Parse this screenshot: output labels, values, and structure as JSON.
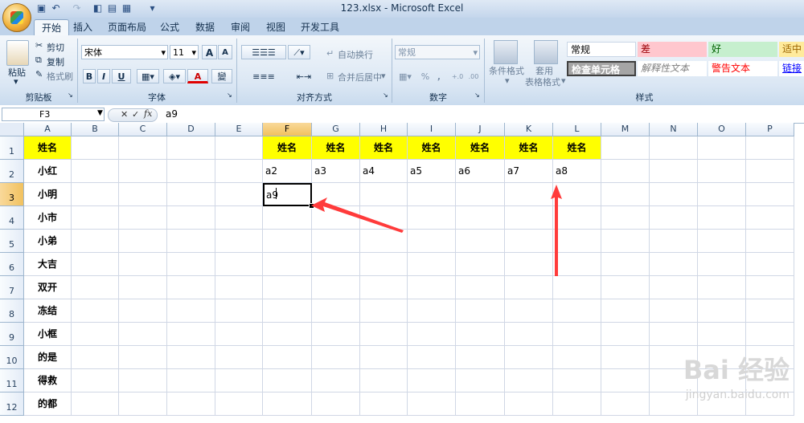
{
  "window": {
    "title": "123.xlsx - Microsoft Excel"
  },
  "tabs": [
    "开始",
    "插入",
    "页面布局",
    "公式",
    "数据",
    "审阅",
    "视图",
    "开发工具"
  ],
  "ribbon": {
    "clipboard": {
      "group": "剪贴板",
      "paste": "粘贴",
      "cut": "剪切",
      "copy": "复制",
      "format_painter": "格式刷"
    },
    "font": {
      "group": "字体",
      "name": "宋体",
      "size": "11",
      "bold": "B",
      "italic": "I",
      "underline": "U",
      "font_color": "A",
      "grow": "A",
      "shrink": "A",
      "phonetic": "變"
    },
    "alignment": {
      "group": "对齐方式",
      "wrap": "自动换行",
      "merge": "合并后居中"
    },
    "number": {
      "group": "数字",
      "format": "常规",
      "percent": "%",
      "comma": ",",
      "increase_decimal": "+.0",
      "decrease_decimal": ".00"
    },
    "styles": {
      "group": "样式",
      "cond_format": "条件格式",
      "table_format_1": "套用",
      "table_format_2": "表格格式",
      "cells": [
        "常规",
        "差",
        "好",
        "适中",
        "检查单元格",
        "解释性文本",
        "警告文本",
        "链接"
      ]
    }
  },
  "formula_bar": {
    "name_box": "F3",
    "cancel": "✕",
    "enter": "✓",
    "fx": "fx",
    "value": "a9"
  },
  "columns": [
    "A",
    "B",
    "C",
    "D",
    "E",
    "F",
    "G",
    "H",
    "I",
    "J",
    "K",
    "L",
    "M",
    "N",
    "O",
    "P"
  ],
  "rows": [
    "1",
    "2",
    "3",
    "4",
    "5",
    "6",
    "7",
    "8",
    "9",
    "10",
    "11",
    "12"
  ],
  "sheet": {
    "a_header": "姓名",
    "a_names": [
      "小红",
      "小明",
      "小市",
      "小弟",
      "大吉",
      "双开",
      "冻结",
      "小框",
      "的是",
      "得救",
      "的都"
    ],
    "row1_headers": [
      "姓名",
      "姓名",
      "姓名",
      "姓名",
      "姓名",
      "姓名",
      "姓名"
    ],
    "row2_values": [
      "a2",
      "a3",
      "a4",
      "a5",
      "a6",
      "a7",
      "a8"
    ],
    "active_value": "a9"
  },
  "watermark": {
    "brand": "Bai 经验",
    "url": "jingyan.baidu.com"
  },
  "colors": {
    "header_fill": "#ffff00",
    "arrow": "#ff3b3b",
    "selected_header": "#f1c15f"
  }
}
